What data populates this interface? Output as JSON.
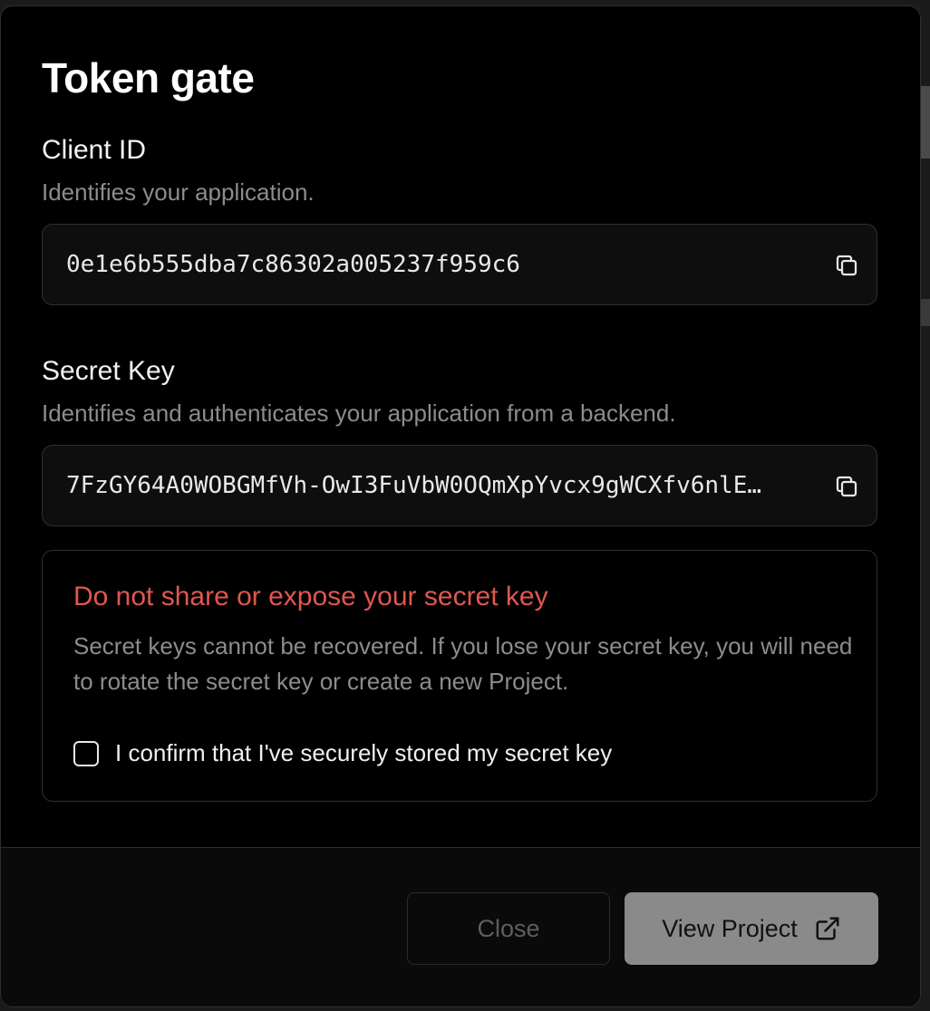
{
  "modal": {
    "title": "Token gate"
  },
  "client_id": {
    "label": "Client ID",
    "help": "Identifies your application.",
    "value": "0e1e6b555dba7c86302a005237f959c6",
    "copy_icon": "copy-icon"
  },
  "secret_key": {
    "label": "Secret Key",
    "help": "Identifies and authenticates your application from a backend.",
    "value": "7FzGY64A0WOBGMfVh-OwI3FuVbW0OQmXpYvcx9gWCXfv6nlE…",
    "copy_icon": "copy-icon"
  },
  "warning": {
    "title": "Do not share or expose your secret key",
    "text": "Secret keys cannot be recovered. If you lose your secret key, you will need to rotate the secret key or create a new Project.",
    "confirm_label": "I confirm that I've securely stored my secret key",
    "confirm_checked": false
  },
  "footer": {
    "close_label": "Close",
    "view_project_label": "View Project",
    "view_project_icon": "external-link-icon"
  },
  "colors": {
    "warning_red": "#e0574f",
    "modal_bg": "#000000",
    "primary_button_bg": "#8a8a8a"
  }
}
